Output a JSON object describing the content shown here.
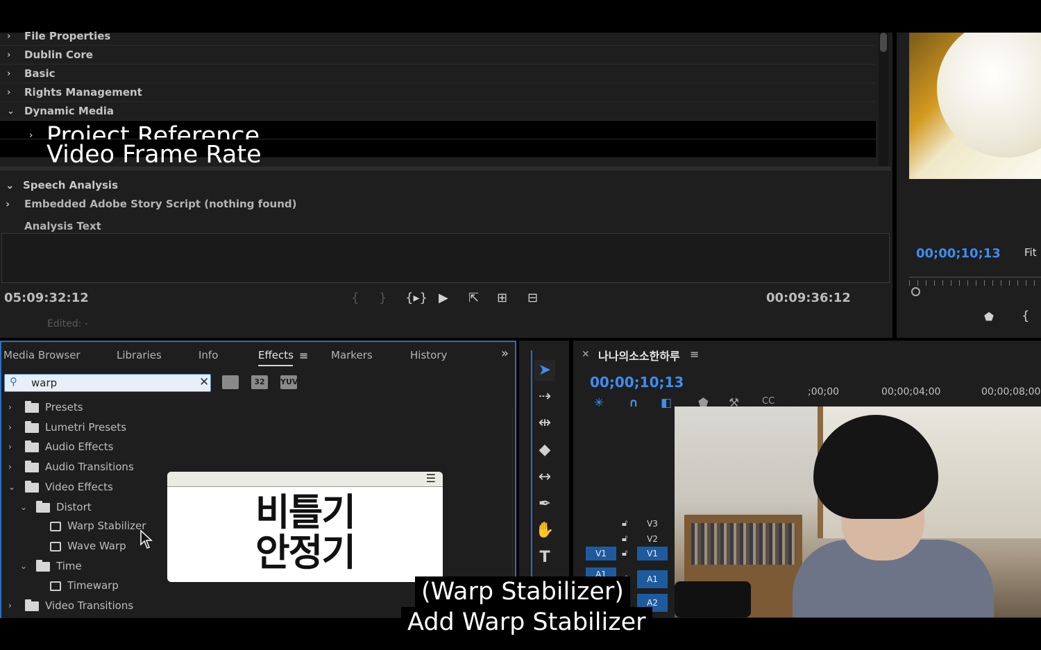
{
  "metadata_panel": {
    "rows": [
      {
        "label": "File Properties",
        "chev": "›"
      },
      {
        "label": "Dublin Core",
        "chev": "›"
      },
      {
        "label": "Basic",
        "chev": "›"
      },
      {
        "label": "Rights Management",
        "chev": "›"
      },
      {
        "label": "Dynamic Media",
        "chev": "⌄"
      }
    ],
    "sub_rows": [
      {
        "label": "Project Reference",
        "chev": "›"
      },
      {
        "label": "Video Frame Rate",
        "chev": ""
      }
    ],
    "speech_analysis": "Speech Analysis",
    "embedded_script": "Embedded Adobe Story Script (nothing found)",
    "analysis_text": "Analysis Text",
    "timecode_in": "05:09:32:12",
    "timecode_out": "00:09:36:12",
    "edited": "Edited: -"
  },
  "program_monitor": {
    "timecode": "00;00;10;13",
    "zoom": "Fit"
  },
  "effects_panel": {
    "tabs": [
      {
        "label": "Media Browser"
      },
      {
        "label": "Libraries"
      },
      {
        "label": "Info"
      },
      {
        "label": "Effects"
      },
      {
        "label": "Markers"
      },
      {
        "label": "History"
      }
    ],
    "overflow": "»",
    "search_value": "warp",
    "badges": [
      "",
      "32",
      "YUV"
    ],
    "tree": [
      {
        "label": "Presets",
        "level": 0,
        "chev": "›",
        "icon": "preset-folder-icon"
      },
      {
        "label": "Lumetri Presets",
        "level": 0,
        "chev": "›",
        "icon": "preset-folder-icon"
      },
      {
        "label": "Audio Effects",
        "level": 0,
        "chev": "›",
        "icon": "folder-icon"
      },
      {
        "label": "Audio Transitions",
        "level": 0,
        "chev": "›",
        "icon": "folder-icon"
      },
      {
        "label": "Video Effects",
        "level": 0,
        "chev": "⌄",
        "icon": "folder-icon"
      },
      {
        "label": "Distort",
        "level": 1,
        "chev": "⌄",
        "icon": "folder-icon"
      },
      {
        "label": "Warp Stabilizer",
        "level": 2,
        "chev": "",
        "icon": "effect-icon"
      },
      {
        "label": "Wave Warp",
        "level": 2,
        "chev": "",
        "icon": "effect-icon"
      },
      {
        "label": "Time",
        "level": 1,
        "chev": "⌄",
        "icon": "folder-icon"
      },
      {
        "label": "Timewarp",
        "level": 2,
        "chev": "",
        "icon": "effect-icon"
      },
      {
        "label": "Video Transitions",
        "level": 0,
        "chev": "›",
        "icon": "folder-icon"
      }
    ]
  },
  "popup": {
    "line1": "비틀기",
    "line2": "안정기"
  },
  "timeline": {
    "sequence_name": "나나의소소한하루",
    "timecode": "00;00;10;13",
    "ruler": [
      ";00;00",
      "00;00;04;00",
      "00;00;08;00"
    ],
    "tracks": [
      {
        "name": "V3",
        "source": ""
      },
      {
        "name": "V2",
        "source": ""
      },
      {
        "name": "V1",
        "source": "V1"
      },
      {
        "name": "A1",
        "source": "A1"
      },
      {
        "name": "A2",
        "source": ""
      }
    ]
  },
  "subtitles": {
    "line1": "(Warp Stabilizer)",
    "line2": "Add Warp Stabilizer"
  },
  "colors": {
    "accent": "#3d8ef0",
    "panel": "#1e1e1e",
    "focus_border": "#2b6fc6"
  }
}
